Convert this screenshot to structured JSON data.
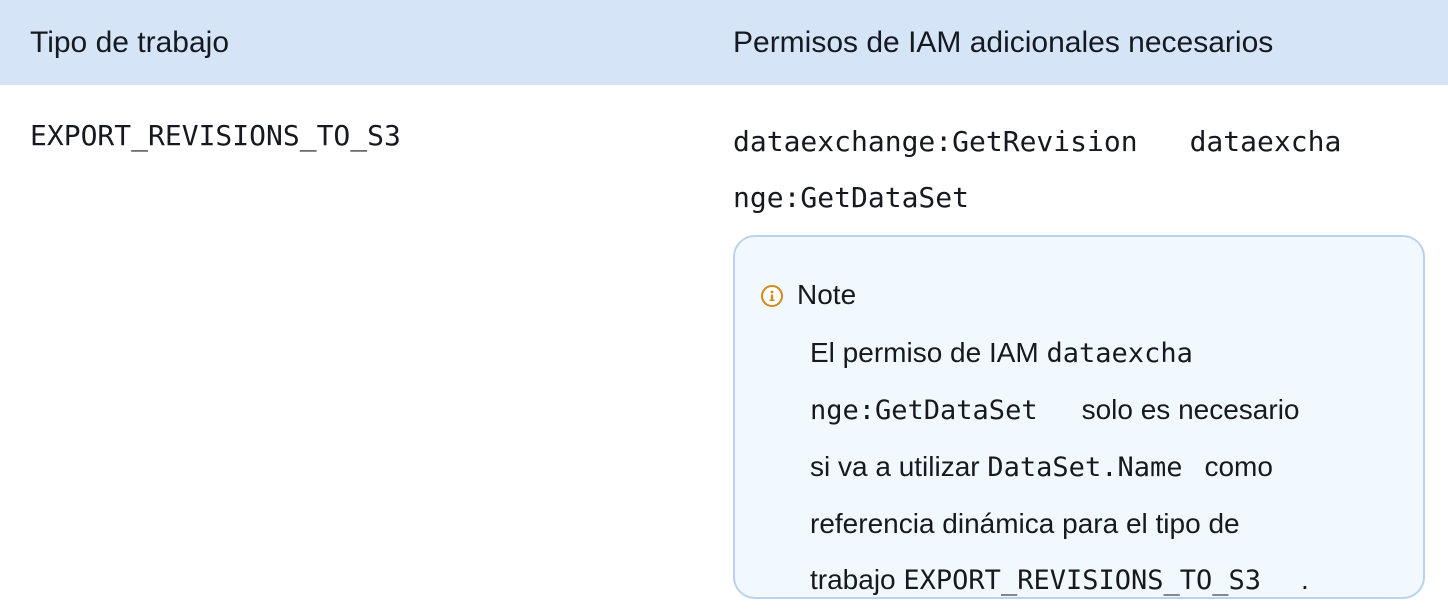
{
  "table": {
    "headers": {
      "job_type": "Tipo de trabajo",
      "permissions": "Permisos de IAM adicionales necesarios"
    },
    "row": {
      "job_type": "EXPORT_REVISIONS_TO_S3",
      "permission_1": "dataexchange:GetRevision",
      "permission_2_part1": "dataexcha",
      "permission_2_part2": "nge:GetDataSet"
    }
  },
  "note": {
    "icon": "info-icon",
    "title": "Note",
    "text_1": "El permiso de IAM ",
    "code_1a": "dataexcha",
    "code_1b": "nge:GetDataSet",
    "text_2": "solo es necesario",
    "text_3": "si va a utilizar ",
    "code_2": "DataSet.Name",
    "text_4": "como",
    "text_5": "referencia dinámica para el tipo de",
    "text_6": "trabajo ",
    "code_3": "EXPORT_REVISIONS_TO_S3",
    "text_7": "."
  },
  "colors": {
    "header_bg": "#d5e4f6",
    "note_bg": "#f1f8fe",
    "note_border": "#b9d3ee",
    "icon_color": "#d48a1a"
  }
}
